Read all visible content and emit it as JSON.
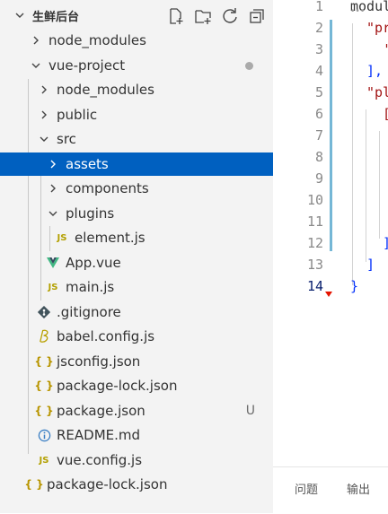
{
  "explorer": {
    "title": "生鲜后台",
    "items": [
      {
        "label": "node_modules"
      },
      {
        "label": "vue-project"
      },
      {
        "label": "node_modules"
      },
      {
        "label": "public"
      },
      {
        "label": "src"
      },
      {
        "label": "assets"
      },
      {
        "label": "components"
      },
      {
        "label": "plugins"
      },
      {
        "label": "element.js"
      },
      {
        "label": "App.vue"
      },
      {
        "label": "main.js"
      },
      {
        "label": ".gitignore"
      },
      {
        "label": "babel.config.js"
      },
      {
        "label": "jsconfig.json"
      },
      {
        "label": "package-lock.json"
      },
      {
        "label": "package.json",
        "status": "U"
      },
      {
        "label": "README.md"
      },
      {
        "label": "vue.config.js"
      },
      {
        "label": "package-lock.json"
      }
    ],
    "icons": {
      "js": "JS",
      "json": "{ }",
      "info": "i"
    }
  },
  "editor": {
    "line_numbers": [
      "1",
      "2",
      "3",
      "4",
      "5",
      "6",
      "7",
      "8",
      "9",
      "10",
      "11",
      "12",
      "13",
      "14"
    ],
    "code": {
      "line1": "modul",
      "line1_fold": "•••",
      "line2": "\"pr",
      "line3": "'",
      "line4": "],",
      "line5": "\"pl",
      "line6": "[",
      "line12": "]",
      "line13": "]",
      "line14": "}"
    }
  },
  "panel": {
    "tabs": [
      "问题",
      "输出"
    ]
  },
  "colors": {
    "selection": "#0060c0",
    "sidebar_bg": "#f3f3f3",
    "js": "#b3a000",
    "vue": "#41b883",
    "string": "#a31515",
    "bracket": "#0431fa"
  }
}
